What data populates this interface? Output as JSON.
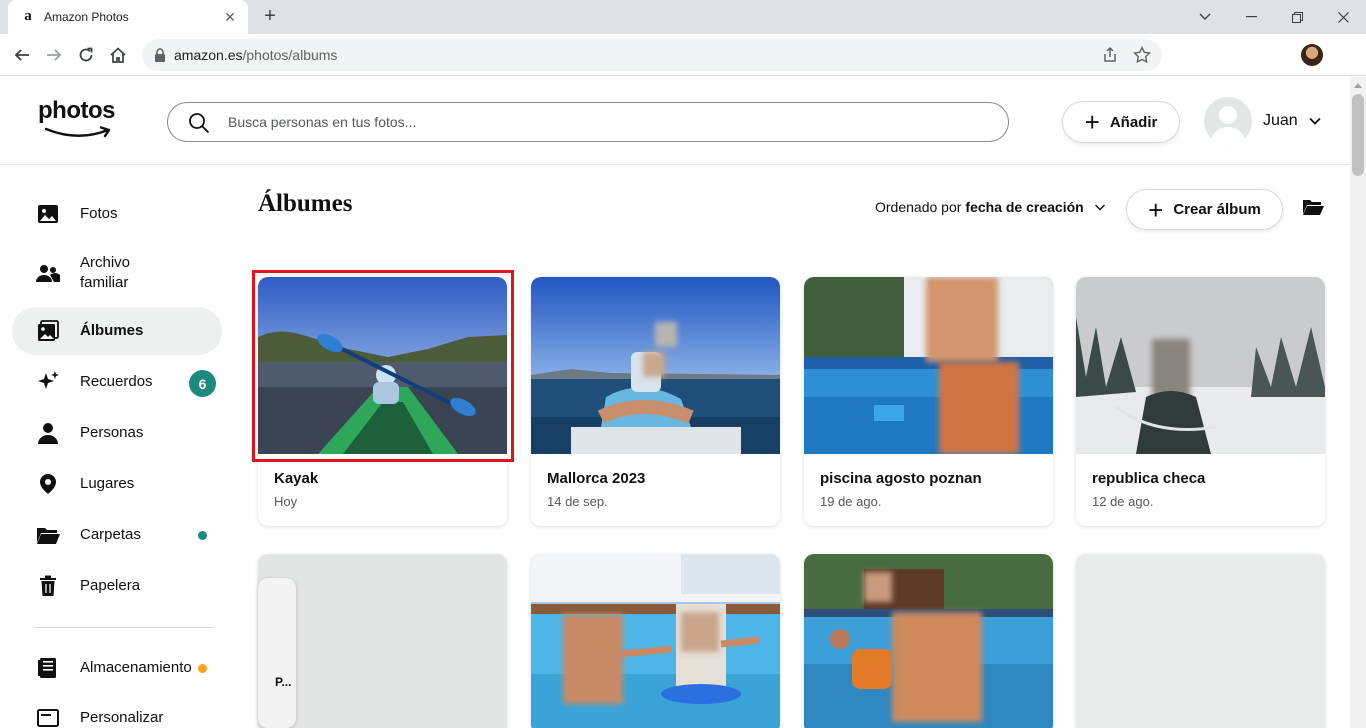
{
  "browser": {
    "tab_title": "Amazon Photos",
    "tab_favicon": "a",
    "url_host": "amazon.es",
    "url_path": "/photos/albums",
    "new_tab": "+",
    "close_tab": "✕"
  },
  "header": {
    "logo_text": "photos",
    "search_placeholder": "Busca personas en tus fotos...",
    "add_label": "Añadir",
    "user_name": "Juan"
  },
  "sidebar": {
    "items": [
      {
        "label": "Fotos",
        "icon": "photo-icon"
      },
      {
        "label": "Archivo familiar",
        "icon": "family-icon"
      },
      {
        "label": "Álbumes",
        "icon": "albums-icon",
        "active": true
      },
      {
        "label": "Recuerdos",
        "icon": "sparkle-icon",
        "badge": "6"
      },
      {
        "label": "Personas",
        "icon": "person-icon"
      },
      {
        "label": "Lugares",
        "icon": "location-pin-icon"
      },
      {
        "label": "Carpetas",
        "icon": "folder-icon"
      },
      {
        "label": "Papelera",
        "icon": "trash-icon"
      },
      {
        "label": "Almacenamiento",
        "icon": "storage-icon"
      },
      {
        "label": "Personalizar",
        "icon": "customize-icon"
      }
    ]
  },
  "main": {
    "title": "Álbumes",
    "sort_prefix": "Ordenado por",
    "sort_value": "fecha de creación",
    "create_label": "Crear álbum",
    "albums": [
      {
        "title": "Kayak",
        "date": "Hoy"
      },
      {
        "title": "Mallorca 2023",
        "date": "14 de sep."
      },
      {
        "title": "piscina agosto poznan",
        "date": "19 de ago."
      },
      {
        "title": "republica checa",
        "date": "12 de ago."
      }
    ],
    "side_pill_text": "P..."
  },
  "colors": {
    "accent_teal": "#1b8a7f",
    "orange_dot": "#f7a21b",
    "selection_red": "#e3121d"
  }
}
